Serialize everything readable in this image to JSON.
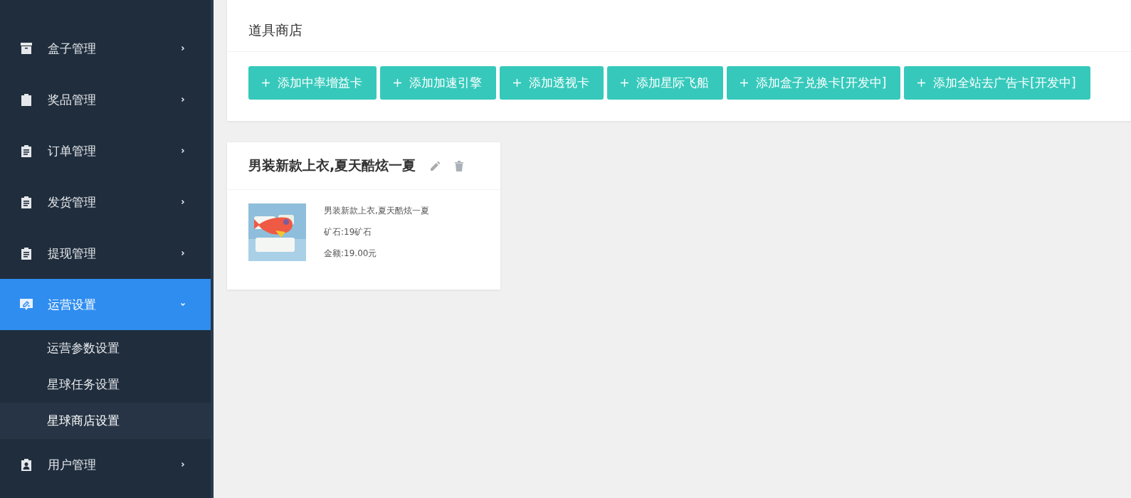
{
  "sidebar": {
    "items": [
      {
        "label": "盒子管理",
        "kind": "archive",
        "selected": false,
        "expanded": false
      },
      {
        "label": "奖品管理",
        "kind": "bag",
        "selected": false,
        "expanded": false
      },
      {
        "label": "订单管理",
        "kind": "clipboard",
        "selected": false,
        "expanded": false
      },
      {
        "label": "发货管理",
        "kind": "clipboard",
        "selected": false,
        "expanded": false
      },
      {
        "label": "提现管理",
        "kind": "clipboard",
        "selected": false,
        "expanded": false
      },
      {
        "label": "运营设置",
        "kind": "chat",
        "selected": true,
        "expanded": true,
        "children": [
          {
            "label": "运营参数设置",
            "selected": false
          },
          {
            "label": "星球任务设置",
            "selected": false
          },
          {
            "label": "星球商店设置",
            "selected": true
          }
        ]
      },
      {
        "label": "用户管理",
        "kind": "person",
        "selected": false,
        "expanded": false
      }
    ]
  },
  "shop": {
    "title": "道具商店",
    "buttons": [
      {
        "label": "添加中率增益卡"
      },
      {
        "label": "添加加速引擎"
      },
      {
        "label": "添加透视卡"
      },
      {
        "label": "添加星际飞船"
      },
      {
        "label": "添加盒子兑换卡[开发中]"
      },
      {
        "label": "添加全站去广告卡[开发中]"
      }
    ]
  },
  "products": [
    {
      "title": "男装新款上衣,夏天酷炫一夏",
      "name": "男装新款上衣,夏天酷炫一夏",
      "ore": "矿石:19矿石",
      "price": "金额:19.00元"
    }
  ]
}
